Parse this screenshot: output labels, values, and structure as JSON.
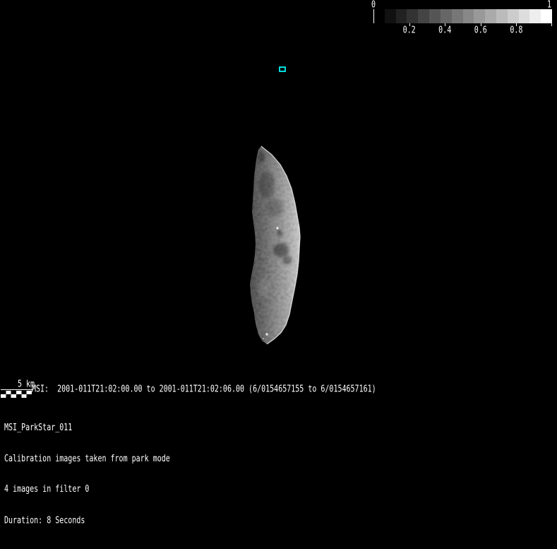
{
  "colorbar": {
    "min_label": "0",
    "max_label": "1",
    "tick_labels": [
      "0.2",
      "0.4",
      "0.6",
      "0.8"
    ],
    "steps": 16,
    "range": [
      0,
      1
    ]
  },
  "star_marker": {
    "color": "#00dcdc"
  },
  "scale_bar": {
    "label": "5 km"
  },
  "status_line": {
    "text": "MSI:  2001-011T21:02:00.00 to 2001-011T21:02:06.00 (6/0154657155 to 6/0154657161)"
  },
  "observation": {
    "sequence_name": "MSI_ParkStar_011",
    "description": "Calibration images taken from park mode",
    "images_line": "4 images in filter 0",
    "duration_line": "Duration: 8 Seconds"
  }
}
